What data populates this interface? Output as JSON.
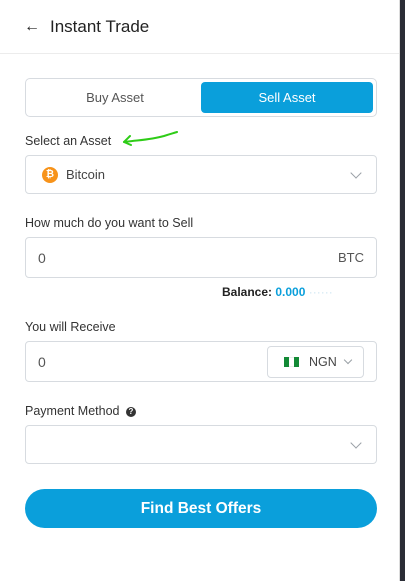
{
  "header": {
    "title": "Instant Trade",
    "back_icon": "arrow-left-icon"
  },
  "tabs": [
    {
      "label": "Buy Asset",
      "active": false
    },
    {
      "label": "Sell Asset",
      "active": true
    }
  ],
  "asset": {
    "label": "Select an Asset",
    "selected": "Bitcoin",
    "icon_glyph": "₿",
    "icon_color": "#f7931a"
  },
  "sell": {
    "label": "How much do you want to Sell",
    "value": "0",
    "unit": "BTC"
  },
  "balance": {
    "label": "Balance:",
    "value": "0.000"
  },
  "receive": {
    "label": "You will Receive",
    "value": "0",
    "currency": "NGN",
    "flag": "nigeria-flag-icon"
  },
  "payment": {
    "label": "Payment Method",
    "help_glyph": "?",
    "value": ""
  },
  "cta": {
    "label": "Find Best Offers"
  },
  "colors": {
    "accent": "#0a9fdb",
    "annotation_arrow": "#2ecc17"
  }
}
